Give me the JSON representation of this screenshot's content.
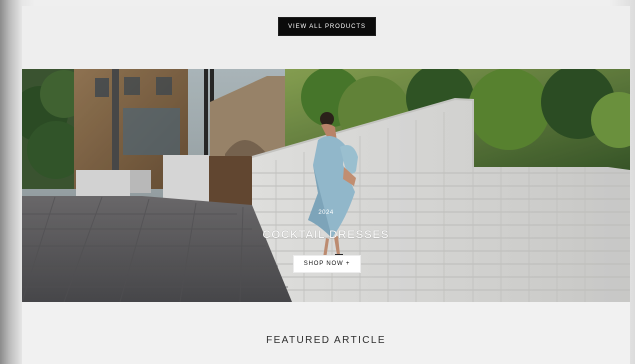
{
  "top_section": {
    "button_label": "VIEW ALL PRODUCTS"
  },
  "hero": {
    "kicker": "2024",
    "title": "COCKTAIL DRESSES",
    "button_label": "SHOP NOW +"
  },
  "featured": {
    "title": "FEATURED ARTICLE"
  },
  "icons": {
    "hero_image": "fashion-photo"
  },
  "colors": {
    "page_background": "#efefef",
    "button_dark": "#0b0b0b",
    "button_light": "#ffffff",
    "hero_text": "#ffffff",
    "heading_text": "#2f2f2f"
  }
}
